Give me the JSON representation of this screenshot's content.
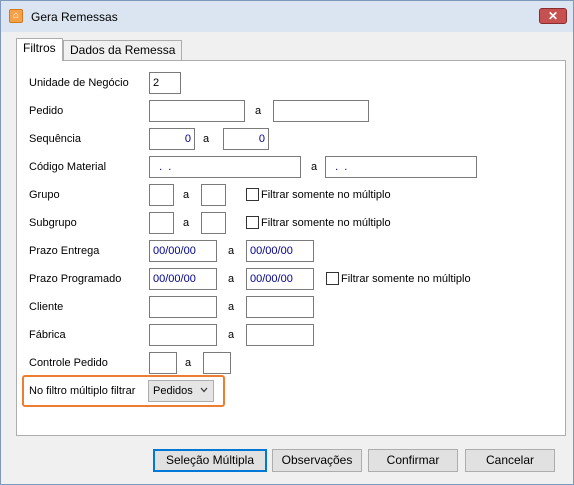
{
  "window": {
    "title": "Gera Remessas",
    "close_glyph": "✕"
  },
  "tabs": [
    {
      "label": "Filtros",
      "active": true
    },
    {
      "label": "Dados da Remessa",
      "active": false
    }
  ],
  "form": {
    "unidade_negocio": {
      "label": "Unidade de Negócio",
      "value": "2"
    },
    "pedido": {
      "label": "Pedido",
      "from": "",
      "sep": "a",
      "to": ""
    },
    "sequencia": {
      "label": "Sequência",
      "from": "0",
      "sep": "a",
      "to": "0"
    },
    "codigo_material": {
      "label": "Código Material",
      "from": "  .  .",
      "sep": "a",
      "to": "  .  ."
    },
    "grupo": {
      "label": "Grupo",
      "from": "",
      "sep": "a",
      "to": "",
      "check_label": "Filtrar somente no múltiplo"
    },
    "subgrupo": {
      "label": "Subgrupo",
      "from": "",
      "sep": "a",
      "to": "",
      "check_label": "Filtrar somente no múltiplo"
    },
    "prazo_entrega": {
      "label": "Prazo Entrega",
      "from": "00/00/00",
      "sep": "a",
      "to": "00/00/00"
    },
    "prazo_programado": {
      "label": "Prazo Programado",
      "from": "00/00/00",
      "sep": "a",
      "to": "00/00/00",
      "check_label": "Filtrar somente no múltiplo"
    },
    "cliente": {
      "label": "Cliente",
      "from": "",
      "sep": "a",
      "to": ""
    },
    "fabrica": {
      "label": "Fábrica",
      "from": "",
      "sep": "a",
      "to": ""
    },
    "controle_pedido": {
      "label": "Controle Pedido",
      "from": "",
      "sep": "a",
      "to": ""
    },
    "filtro_multiplo": {
      "label": "No filtro múltiplo filtrar",
      "selected": "Pedidos"
    }
  },
  "buttons": {
    "selecao_multipla": "Seleção Múltipla",
    "observacoes": "Observações",
    "confirmar": "Confirmar",
    "cancelar": "Cancelar"
  },
  "colors": {
    "highlight": "#ed7d31",
    "field_text": "#00008b",
    "accent": "#0078d7"
  }
}
